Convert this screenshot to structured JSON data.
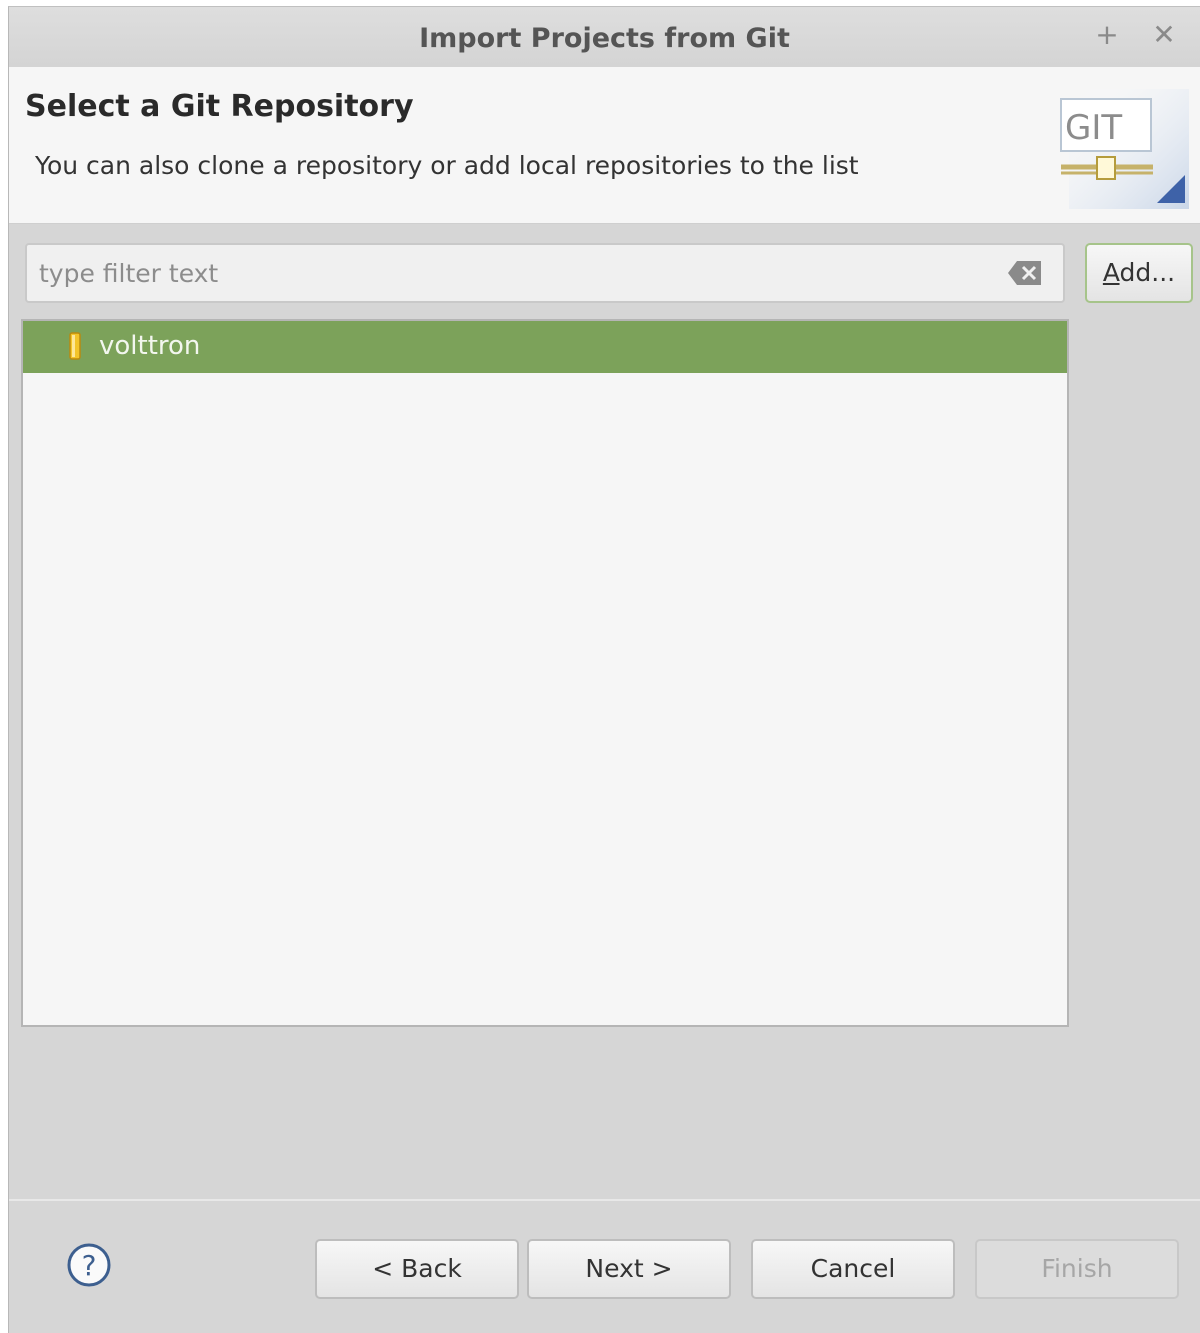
{
  "window": {
    "title": "Import Projects from Git",
    "pin_glyph": "+",
    "close_glyph": "✕"
  },
  "header": {
    "title": "Select a Git Repository",
    "description": "You can also clone a repository or add local repositories to the list",
    "logo_text": "GIT"
  },
  "filter": {
    "placeholder": "type filter text",
    "value": ""
  },
  "add_button": {
    "label_mnemonic": "A",
    "label_rest": "dd..."
  },
  "repositories": [
    {
      "name": "volttron",
      "selected": true
    }
  ],
  "footer": {
    "back_label": "< Back",
    "next_label": "Next >",
    "cancel_label": "Cancel",
    "finish_label": "Finish",
    "finish_enabled": false
  },
  "colors": {
    "selection": "#7ca25a",
    "add_button_border": "#a6c48a"
  }
}
